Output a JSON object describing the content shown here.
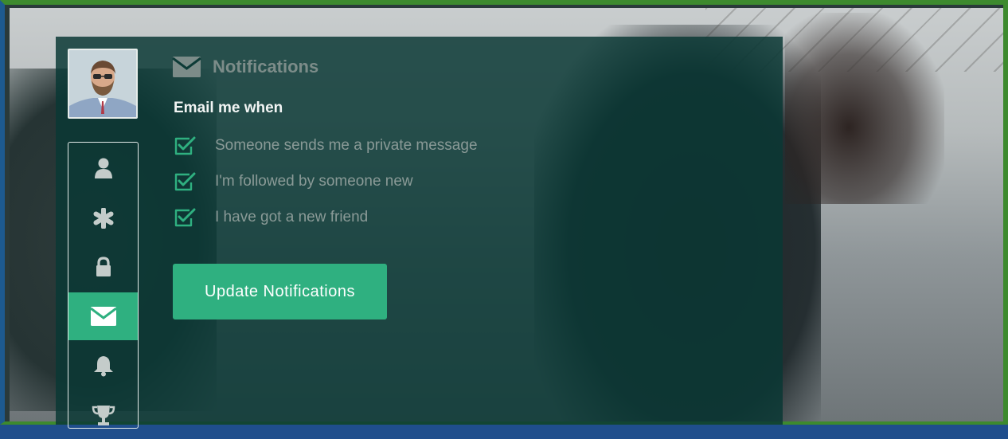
{
  "colors": {
    "accent": "#2fb080",
    "panel": "#0a3834",
    "frame_green": "#3d8a2e",
    "frame_blue": "#1d5a8f",
    "muted_text": "#8a9a97",
    "heading_text": "#7c8c89"
  },
  "profile": {
    "avatar_icon": "user-photo"
  },
  "sidebar": {
    "items": [
      {
        "icon": "user-icon",
        "active": false
      },
      {
        "icon": "asterisk-icon",
        "active": false
      },
      {
        "icon": "lock-icon",
        "active": false
      },
      {
        "icon": "envelope-icon",
        "active": true
      },
      {
        "icon": "bell-icon",
        "active": false
      },
      {
        "icon": "trophy-icon",
        "active": false
      }
    ]
  },
  "notifications": {
    "title": "Notifications",
    "title_icon": "envelope-icon",
    "section_label": "Email me when",
    "options": [
      {
        "label": "Someone sends me a private message",
        "checked": true
      },
      {
        "label": "I'm followed by someone new",
        "checked": true
      },
      {
        "label": "I have got a new friend",
        "checked": true
      }
    ],
    "submit_label": "Update Notifications"
  }
}
